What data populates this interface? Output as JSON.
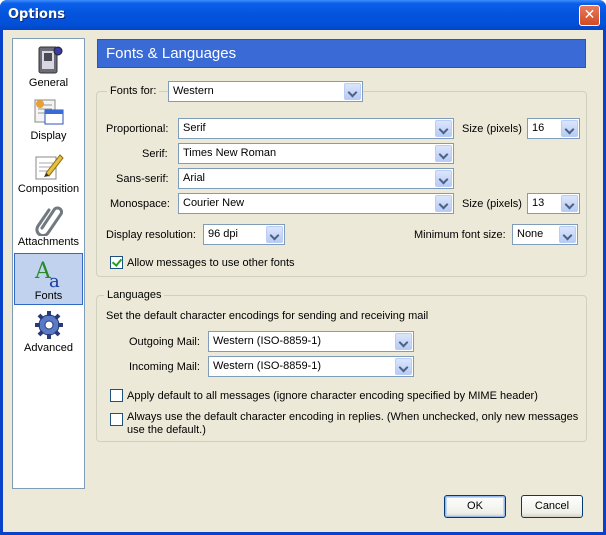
{
  "window": {
    "title": "Options",
    "close_glyph": "✕"
  },
  "sidebar": {
    "items": [
      {
        "label": "General",
        "icon": "switch-icon"
      },
      {
        "label": "Display",
        "icon": "display-icon"
      },
      {
        "label": "Composition",
        "icon": "pen-paper-icon"
      },
      {
        "label": "Attachments",
        "icon": "paperclip-icon"
      },
      {
        "label": "Fonts",
        "icon": "fonts-icon",
        "selected": true
      },
      {
        "label": "Advanced",
        "icon": "gear-icon"
      }
    ]
  },
  "header": {
    "title": "Fonts & Languages"
  },
  "fonts": {
    "fonts_for_label": "Fonts for:",
    "fonts_for_value": "Western",
    "proportional_label": "Proportional:",
    "proportional_value": "Serif",
    "size_label_1": "Size (pixels)",
    "size_value_1": "16",
    "serif_label": "Serif:",
    "serif_value": "Times New Roman",
    "sans_label": "Sans-serif:",
    "sans_value": "Arial",
    "mono_label": "Monospace:",
    "mono_value": "Courier New",
    "size_label_2": "Size (pixels)",
    "size_value_2": "13",
    "resolution_label": "Display resolution:",
    "resolution_value": "96 dpi",
    "min_font_label": "Minimum font size:",
    "min_font_value": "None",
    "allow_label": "Allow messages to use other fonts",
    "allow_checked": true
  },
  "languages": {
    "legend": "Languages",
    "description": "Set the default character encodings for sending and receiving mail",
    "outgoing_label": "Outgoing Mail:",
    "outgoing_value": "Western (ISO-8859-1)",
    "incoming_label": "Incoming Mail:",
    "incoming_value": "Western (ISO-8859-1)",
    "apply_label": "Apply default to all messages (ignore character encoding specified by MIME header)",
    "always_label_line1": "Always use the default character encoding in replies. (When unchecked, only new messages",
    "always_label_line2": "use the default.)"
  },
  "buttons": {
    "ok": "OK",
    "cancel": "Cancel"
  }
}
